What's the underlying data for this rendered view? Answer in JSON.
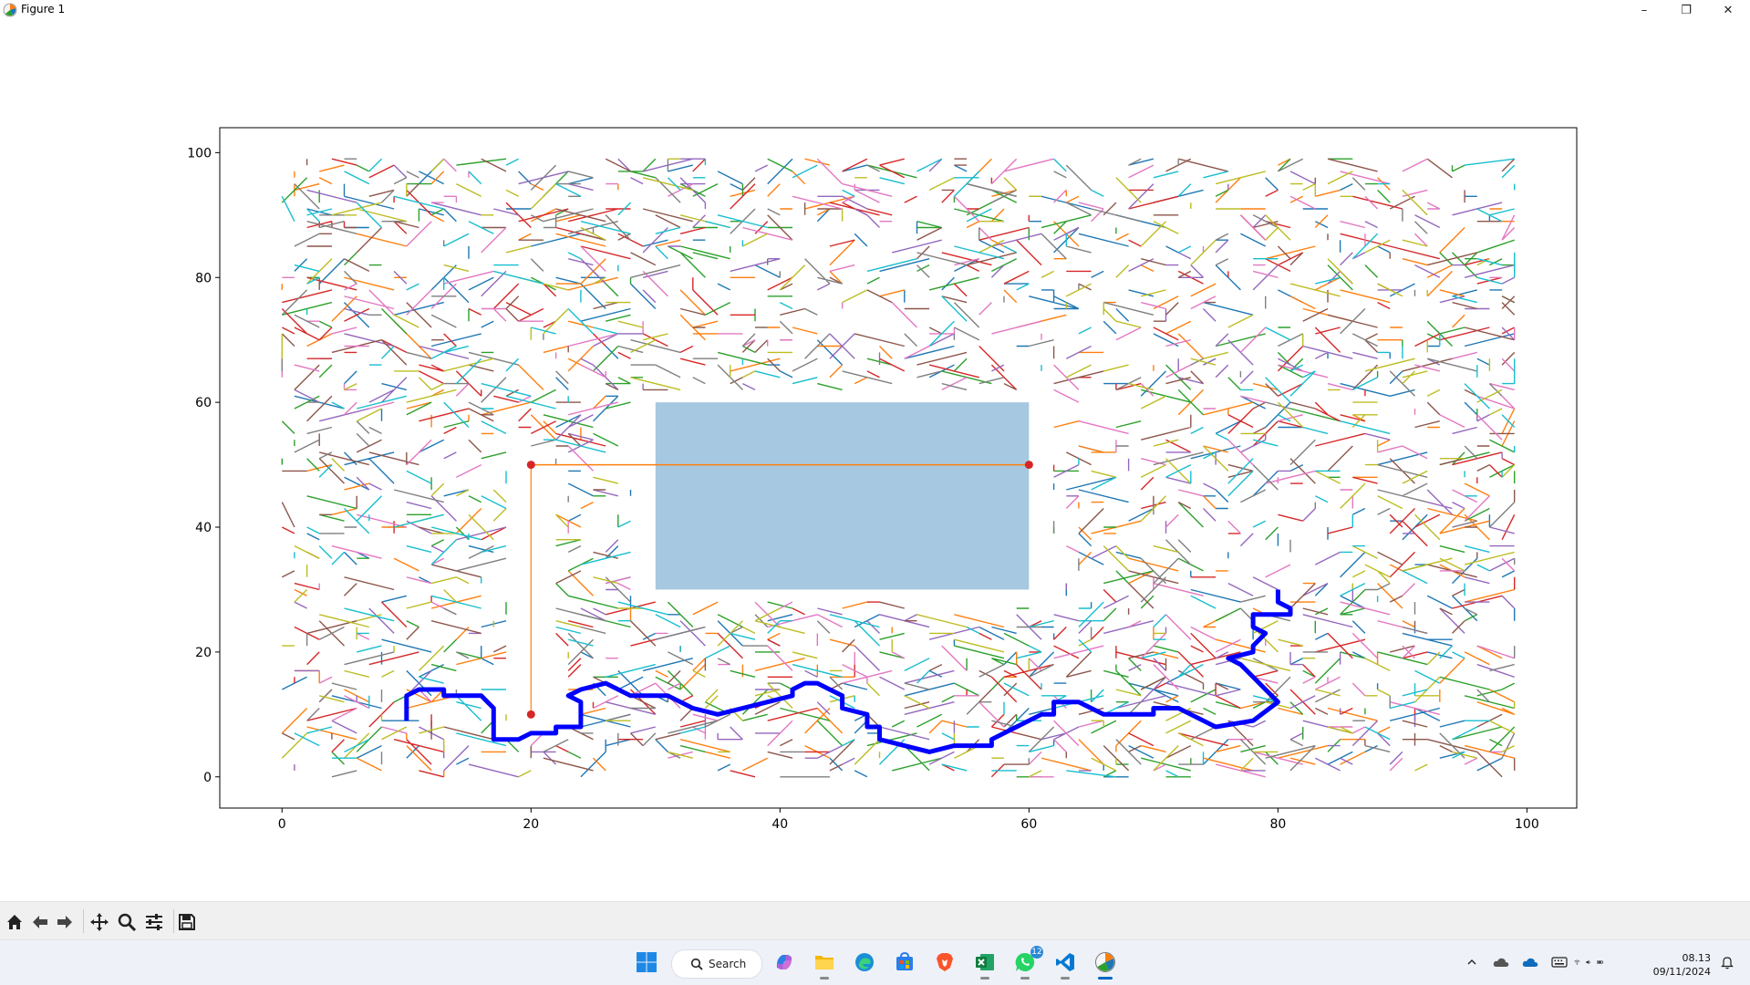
{
  "window": {
    "title": "Figure 1",
    "minimize_glyph": "–",
    "maximize_glyph": "❐",
    "close_glyph": "✕",
    "app_icon": "matplotlib-icon"
  },
  "chart_data": {
    "type": "line",
    "title": "",
    "xlabel": "",
    "ylabel": "",
    "xlim": [
      -5,
      104
    ],
    "ylim": [
      -5,
      104
    ],
    "xticks": [
      0,
      20,
      40,
      60,
      80,
      100
    ],
    "yticks": [
      0,
      20,
      40,
      60,
      80,
      100
    ],
    "grid": false,
    "legend": "none",
    "background_graph": {
      "description_free": true,
      "extent": {
        "x": [
          0,
          99
        ],
        "y": [
          0,
          99
        ]
      },
      "colors": [
        "#1f77b4",
        "#ff7f0e",
        "#2ca02c",
        "#d62728",
        "#9467bd",
        "#8c564b",
        "#e377c2",
        "#7f7f7f",
        "#bcbd22",
        "#17becf"
      ]
    },
    "obstacles": [
      {
        "x": [
          30,
          60
        ],
        "y": [
          30,
          60
        ],
        "color": "#a6c8e0"
      },
      {
        "x": [
          19.5,
          20.5
        ],
        "y": [
          10,
          50
        ],
        "color": "#ffffff"
      }
    ],
    "markers": [
      {
        "x": 20,
        "y": 50,
        "color": "#d62728"
      },
      {
        "x": 60,
        "y": 50,
        "color": "#d62728"
      },
      {
        "x": 20,
        "y": 10,
        "color": "#d62728"
      }
    ],
    "connector_line": {
      "x": [
        20,
        60
      ],
      "y": [
        50,
        50
      ],
      "color": "#ff7f0e"
    },
    "vertical_line": {
      "x": [
        20,
        20
      ],
      "y": [
        10,
        50
      ],
      "color": "#ff7f0e"
    },
    "path": {
      "color": "#0000ff",
      "x": [
        10,
        10,
        11,
        13,
        13,
        16,
        17,
        17,
        19,
        20,
        22,
        22,
        24,
        24,
        23,
        24,
        26,
        28,
        31,
        32,
        33,
        35,
        37,
        39,
        41,
        41,
        42,
        43,
        44,
        45,
        45,
        47,
        47,
        48,
        48,
        50,
        52,
        54,
        57,
        57,
        59,
        61,
        62,
        62,
        64,
        66,
        69,
        70,
        70,
        72,
        73,
        74,
        75,
        78,
        80,
        79,
        78,
        77,
        76,
        78,
        78,
        79,
        78,
        78,
        80,
        81,
        81,
        80,
        80
      ],
      "y": [
        9,
        13,
        14,
        14,
        13,
        13,
        11,
        6,
        6,
        7,
        7,
        8,
        8,
        12,
        13,
        14,
        15,
        13,
        13,
        12,
        11,
        10,
        11,
        12,
        13,
        14,
        15,
        15,
        14,
        13,
        11,
        10,
        8,
        8,
        6,
        5,
        4,
        5,
        5,
        6,
        8,
        10,
        10,
        12,
        12,
        10,
        10,
        10,
        11,
        11,
        10,
        9,
        8,
        9,
        12,
        14,
        16,
        18,
        19,
        20,
        21,
        23,
        24,
        26,
        26,
        26,
        27,
        28,
        30
      ]
    }
  },
  "toolbar": {
    "buttons": [
      "home-icon",
      "back-icon",
      "forward-icon",
      "pan-icon",
      "zoom-icon",
      "configure-icon",
      "save-icon"
    ]
  },
  "taskbar": {
    "search_label": "Search",
    "whatsapp_badge": "12",
    "time": "08.13",
    "date": "09/11/2024",
    "apps": [
      "start-icon",
      "copilot-icon",
      "file-explorer-icon",
      "edge-icon",
      "store-icon",
      "brave-icon",
      "excel-icon",
      "whatsapp-icon",
      "vscode-icon",
      "matplotlib-icon"
    ]
  }
}
